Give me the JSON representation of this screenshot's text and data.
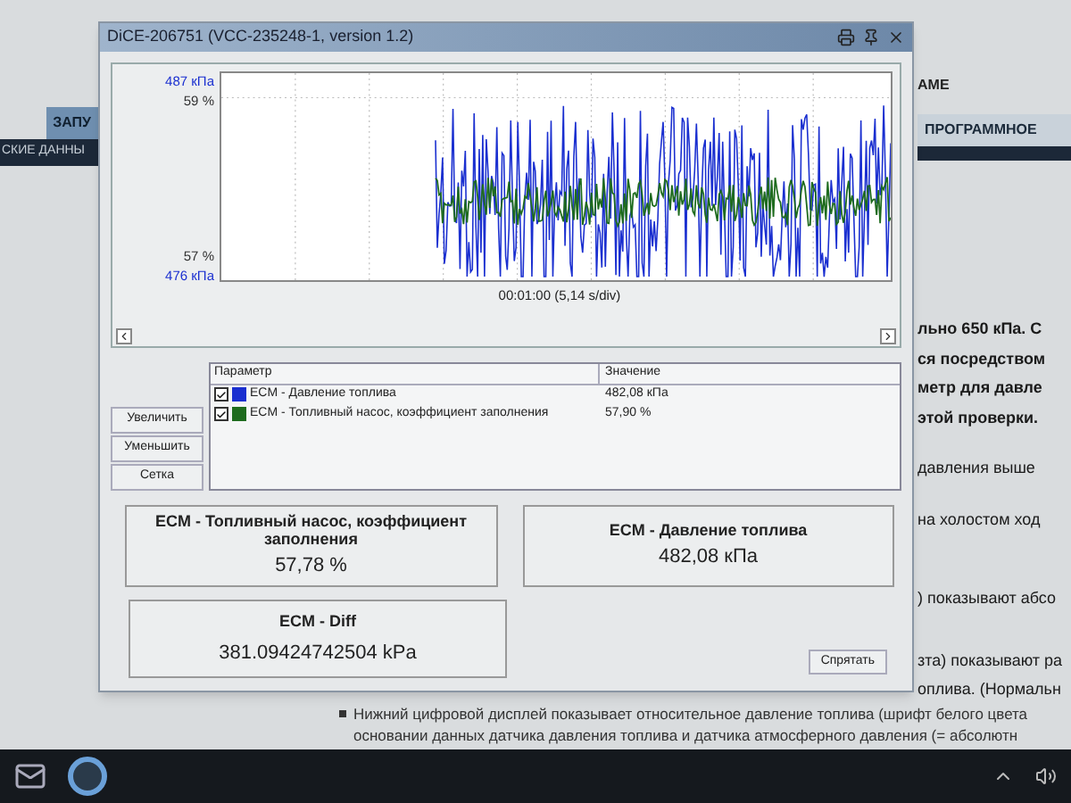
{
  "background_page": {
    "header_text": "AME",
    "tabs": [
      {
        "label": "ЗАПУ",
        "selected": true
      },
      {
        "label": "ПРОГРАММНОЕ",
        "selected": false
      }
    ],
    "section_bar": "СКИЕ ДАННЫ",
    "side_lines": [
      {
        "text": "льно 650 кПа. С",
        "bold": true
      },
      {
        "text": "ся посредством",
        "bold": true
      },
      {
        "text": "метр для давле",
        "bold": true
      },
      {
        "text": "этой проверки.",
        "bold": true
      },
      {
        "text": "давления выше",
        "bold": false
      },
      {
        "text": "на холостом ход",
        "bold": false
      },
      {
        "text": ") показывают абсо",
        "bold": false
      },
      {
        "text": "зта) показывают ра",
        "bold": false
      },
      {
        "text": "оплива. (Нормальн",
        "bold": false
      }
    ],
    "bullet_lines": [
      "Нижний цифровой дисплей показывает относительное давление топлива (шрифт белого цвета",
      "основании данных датчика давления топлива и датчика атмосферного давления (= абсолютн"
    ]
  },
  "dialog": {
    "title": "DiCE-206751  (VCC-235248-1, version 1.2)",
    "chart": {
      "top_pressure": "487 кПа",
      "top_percent": "59 %",
      "bottom_percent": "57 %",
      "bottom_pressure": "476 кПа",
      "time_label": "00:01:00 (5,14 s/div)"
    },
    "buttons": [
      "Увеличить",
      "Уменьшить",
      "Сетка"
    ],
    "table": {
      "columns": [
        "Параметр",
        "Значение"
      ],
      "rows": [
        {
          "checked": true,
          "color": "#1a2fd0",
          "parameter": "ECM - Давление топлива",
          "value": "482,08 кПа"
        },
        {
          "checked": true,
          "color": "#1e6b1e",
          "parameter": "ECM - Топливный насос, коэффициент заполнения",
          "value": "57,90 %"
        }
      ]
    },
    "readouts": [
      {
        "title": "ECM - Топливный насос, коэффициент заполнения",
        "value": "57,78 %"
      },
      {
        "title": "ECM - Давление топлива",
        "value": "482,08 кПа"
      },
      {
        "title": "ECM - Diff",
        "value": "381.09424742504 kPa"
      }
    ],
    "hide_button": "Спрятать"
  }
}
